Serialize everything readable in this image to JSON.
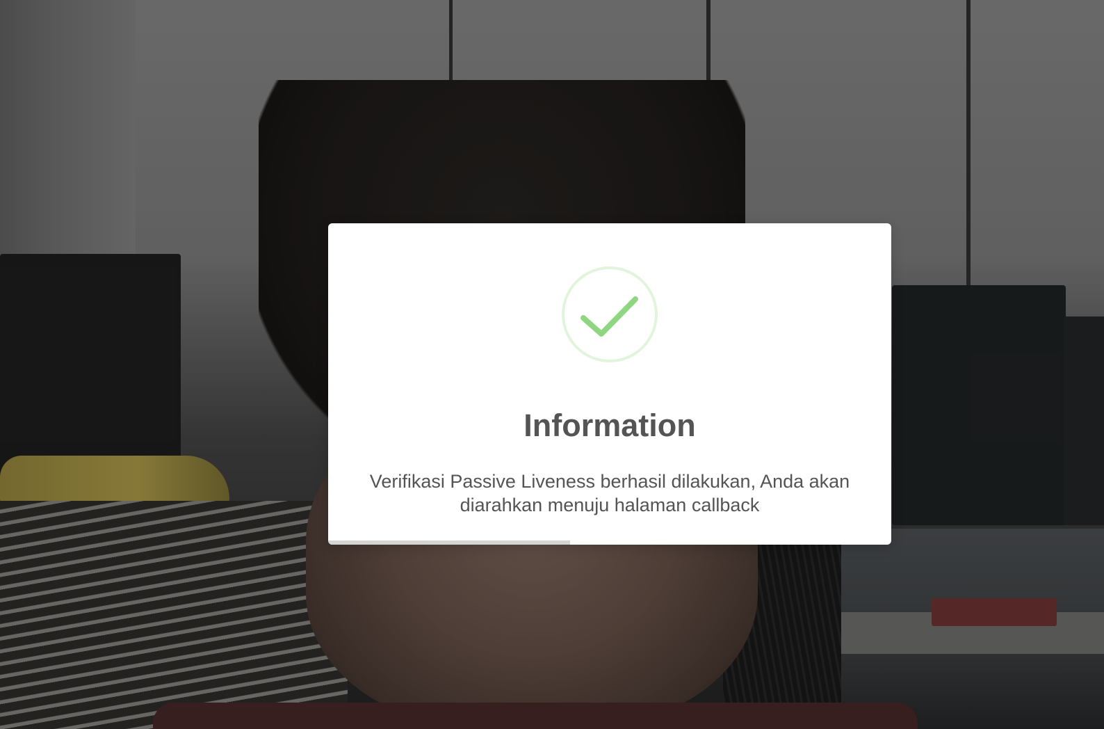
{
  "dialog": {
    "icon": "success-check-icon",
    "title": "Information",
    "message": "Verifikasi Passive Liveness berhasil dilakukan, Anda akan diarahkan menuju halaman callback",
    "timer_progress": 0.43
  },
  "colors": {
    "success_ring": "#e3f4dc",
    "success_check": "#8fd680",
    "title_text": "#545454",
    "timer_bar": "#d5d5d5"
  }
}
